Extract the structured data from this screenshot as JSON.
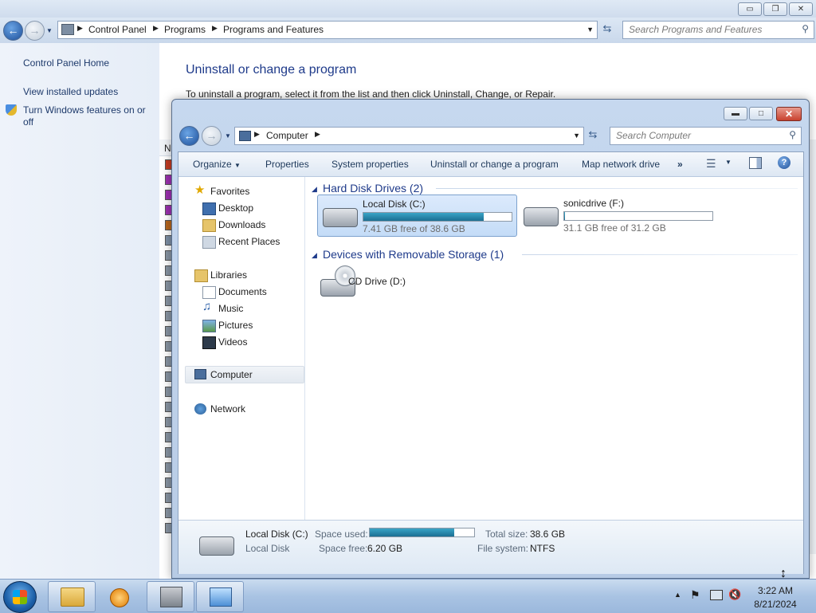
{
  "control_panel": {
    "caption_buttons": [
      "▭",
      "❐",
      "✕"
    ],
    "breadcrumb": [
      "Control Panel",
      "Programs",
      "Programs and Features"
    ],
    "search_placeholder": "Search Programs and Features",
    "left_links": [
      "Control Panel Home",
      "View installed updates",
      "Turn Windows features on or",
      "off"
    ],
    "heading": "Uninstall or change a program",
    "description": "To uninstall a program, select it from the list and then click Uninstall, Change, or Repair.",
    "list_column_fragment": "N"
  },
  "computer_window": {
    "breadcrumb": [
      "Computer"
    ],
    "search_placeholder": "Search Computer",
    "toolbar": {
      "organize": "Organize",
      "properties": "Properties",
      "system_properties": "System properties",
      "uninstall": "Uninstall or change a program",
      "map_network_drive": "Map network drive",
      "more": "»"
    },
    "nav": {
      "favorites": "Favorites",
      "desktop": "Desktop",
      "downloads": "Downloads",
      "recent_places": "Recent Places",
      "libraries": "Libraries",
      "documents": "Documents",
      "music": "Music",
      "pictures": "Pictures",
      "videos": "Videos",
      "computer": "Computer",
      "network": "Network"
    },
    "groups": {
      "hard_disk": "Hard Disk Drives (2)",
      "removable": "Devices with Removable Storage (1)"
    },
    "drives": [
      {
        "name": "Local Disk (C:)",
        "free_text": "7.41 GB free of 38.6 GB",
        "used_fraction": 0.81
      },
      {
        "name": "sonicdrive (F:)",
        "free_text": "31.1 GB free of 31.2 GB",
        "used_fraction": 0.003
      }
    ],
    "cd_drive": "CD Drive (D:)",
    "details": {
      "name": "Local Disk (C:)",
      "type": "Local Disk",
      "space_used_label": "Space used:",
      "space_free_label": "Space free:",
      "space_free": "6.20 GB",
      "total_size_label": "Total size:",
      "total_size": "38.6 GB",
      "file_system_label": "File system:",
      "file_system": "NTFS",
      "used_fraction": 0.81
    }
  },
  "taskbar": {
    "time": "3:22 AM",
    "date": "8/21/2024"
  },
  "colors": {
    "link": "#1e3a8a",
    "bar_fill": "#2a8db3",
    "close_red": "#c8412e"
  }
}
